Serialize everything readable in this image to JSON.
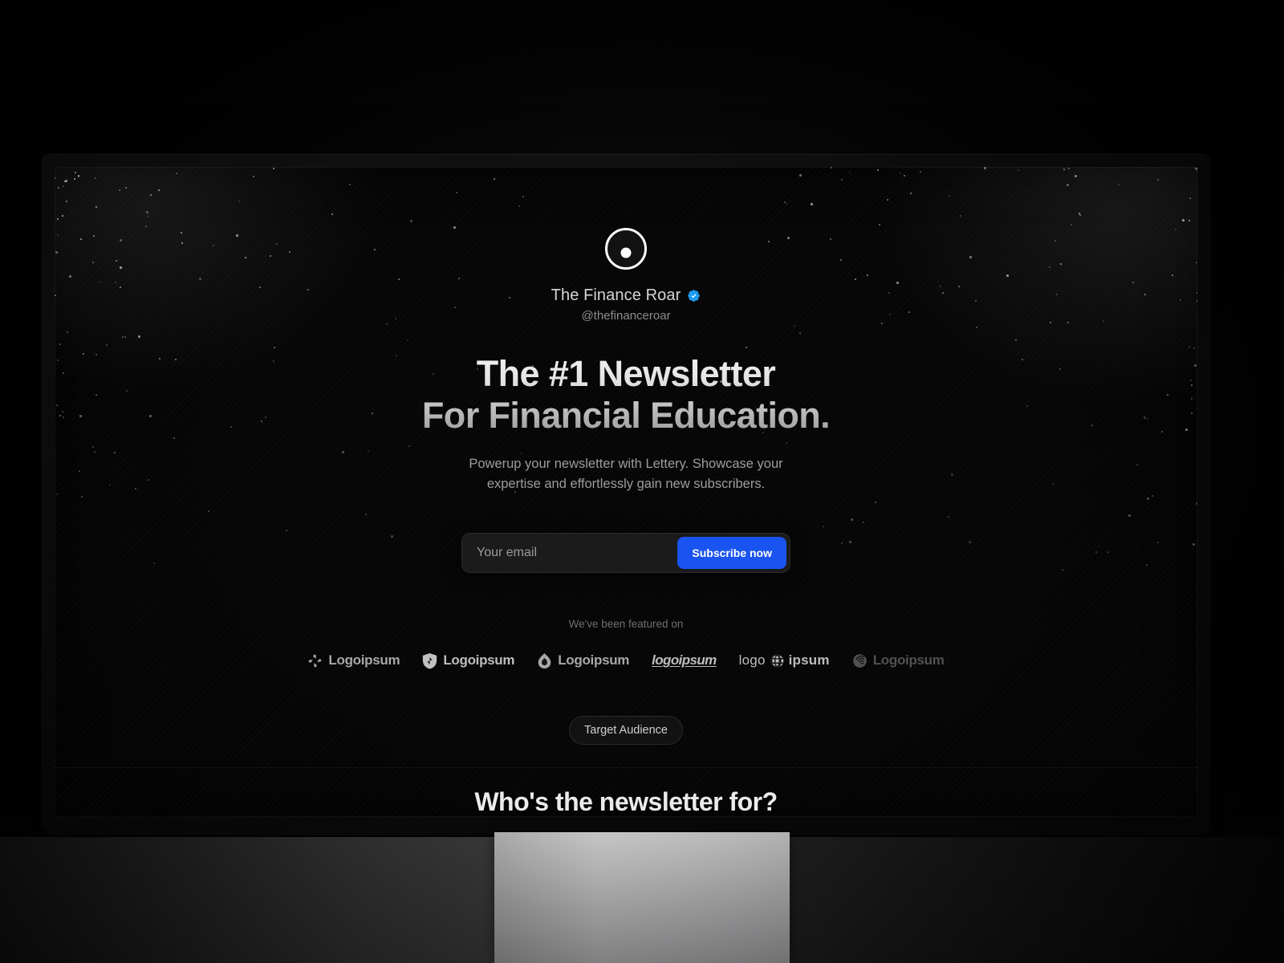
{
  "site": {
    "profile": {
      "avatar_icon": "circle-dot-avatar-icon",
      "name": "The Finance Roar",
      "verified_icon": "verified-badge-icon",
      "handle": "@thefinanceroar"
    },
    "hero": {
      "headline_line1": "The #1 Newsletter",
      "headline_line2": "For Financial Education.",
      "subhead": "Powerup your newsletter with Lettery. Showcase your expertise and effortlessly gain new subscribers."
    },
    "subscribe": {
      "email_placeholder": "Your email",
      "email_value": "",
      "button_label": "Subscribe now",
      "button_color": "#1a54f0"
    },
    "featured": {
      "label": "We've been featured on",
      "logos": [
        {
          "text": "Logoipsum",
          "icon": "pinwheel-icon",
          "style": "normal"
        },
        {
          "text": "Logoipsum",
          "icon": "shield-icon",
          "style": "light"
        },
        {
          "text": "Logoipsum",
          "icon": "droplet-icon",
          "style": "normal"
        },
        {
          "text": "logoipsum",
          "icon": "none",
          "style": "italic"
        },
        {
          "text": "ipsum",
          "icon": "globe-icon",
          "style": "spaced",
          "prefix": "logo"
        },
        {
          "text": "Logoipsum",
          "icon": "spiral-icon",
          "style": "dim"
        }
      ]
    },
    "audience": {
      "pill_label": "Target Audience",
      "section_title": "Who's the newsletter for?"
    }
  }
}
